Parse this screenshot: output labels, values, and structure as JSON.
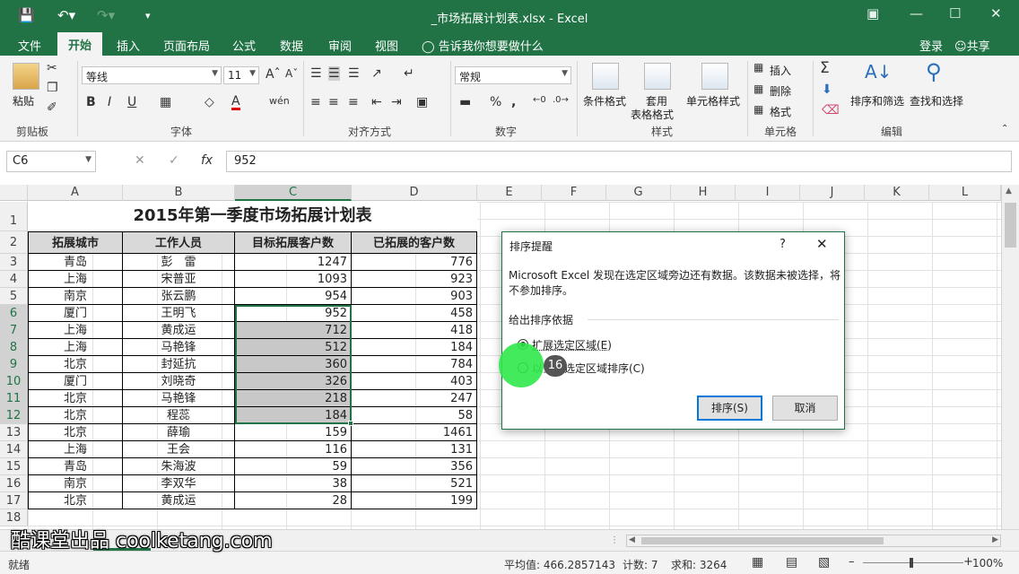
{
  "window": {
    "title": "_市场拓展计划表.xlsx - Excel"
  },
  "tabs": [
    "文件",
    "开始",
    "插入",
    "页面布局",
    "公式",
    "数据",
    "审阅",
    "视图"
  ],
  "active_tab": "开始",
  "tell_me": "告诉我你想要做什么",
  "login": "登录",
  "share": "共享",
  "ribbon": {
    "paste": "粘贴",
    "clipboard": "剪贴板",
    "font_name": "等线",
    "font_size": "11",
    "font_group": "字体",
    "align_group": "对齐方式",
    "number_format": "常规",
    "number_group": "数字",
    "cond_format": "条件格式",
    "table_format_1": "套用",
    "table_format_2": "表格格式",
    "cell_style": "单元格样式",
    "style_group": "样式",
    "insert": "插入",
    "delete": "删除",
    "format": "格式",
    "cells_group": "单元格",
    "sort_filter": "排序和筛选",
    "find_select": "查找和选择",
    "edit_group": "编辑"
  },
  "formula_bar": {
    "name_box": "C6",
    "value": "952"
  },
  "columns": [
    "A",
    "B",
    "C",
    "D",
    "E",
    "F",
    "G",
    "H",
    "I",
    "J",
    "K",
    "L"
  ],
  "rows": [
    "1",
    "2",
    "3",
    "4",
    "5",
    "6",
    "7",
    "8",
    "9",
    "10",
    "11",
    "12",
    "13",
    "14",
    "15",
    "16",
    "17",
    "18"
  ],
  "sheet": {
    "title": "2015年第一季度市场拓展计划表",
    "headers": [
      "拓展城市",
      "工作人员",
      "目标拓展客户数",
      "已拓展的客户数"
    ],
    "data": [
      [
        "青岛",
        "彭　雷",
        "1247",
        "776"
      ],
      [
        "上海",
        "宋普亚",
        "1093",
        "923"
      ],
      [
        "南京",
        "张云鹏",
        "954",
        "903"
      ],
      [
        "厦门",
        "王明飞",
        "952",
        "458"
      ],
      [
        "上海",
        "黄成运",
        "712",
        "418"
      ],
      [
        "上海",
        "马艳锋",
        "512",
        "184"
      ],
      [
        "北京",
        "封延抗",
        "360",
        "784"
      ],
      [
        "厦门",
        "刘晓奇",
        "326",
        "403"
      ],
      [
        "北京",
        "马艳锋",
        "218",
        "247"
      ],
      [
        "北京",
        "程蕊",
        "184",
        "58"
      ],
      [
        "北京",
        "薛瑜",
        "159",
        "1461"
      ],
      [
        "上海",
        "王会",
        "116",
        "131"
      ],
      [
        "青岛",
        "朱海波",
        "59",
        "356"
      ],
      [
        "南京",
        "李双华",
        "38",
        "521"
      ],
      [
        "北京",
        "黄成运",
        "28",
        "199"
      ]
    ]
  },
  "dialog": {
    "title": "排序提醒",
    "help": "?",
    "message": "Microsoft Excel 发现在选定区域旁边还有数据。该数据未被选择，将不参加排序。",
    "section": "给出排序依据",
    "option_expand": "扩展选定区域(E)",
    "option_current": "以当前选定区域排序(C)",
    "sort_button": "排序(S)",
    "cancel_button": "取消"
  },
  "cursor_badge": "16",
  "status": {
    "ready": "就绪",
    "average": "平均值: 466.2857143",
    "count": "计数: 7",
    "sum": "求和: 3264",
    "zoom": "100%"
  },
  "watermark": "酷课堂出品 coolketang.com",
  "colors": {
    "excel_green": "#217346",
    "selection_gray": "#c8c8c8",
    "cursor_green": "#2ee84a"
  }
}
